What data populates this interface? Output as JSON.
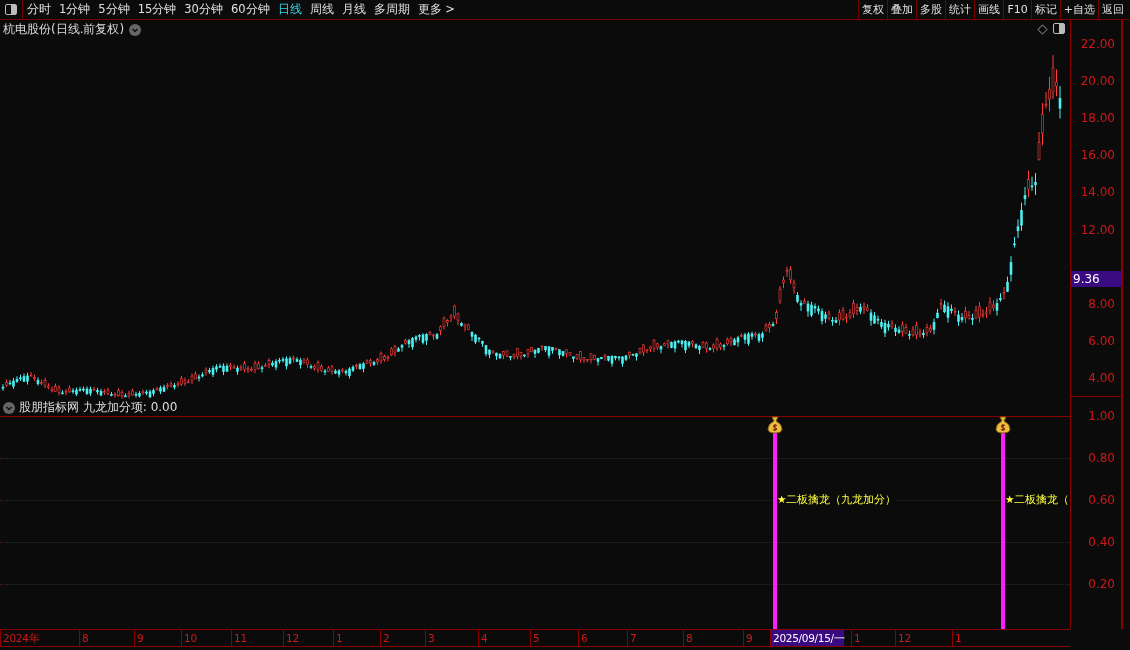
{
  "toolbar": {
    "periods": [
      {
        "label": "分时",
        "selected": false
      },
      {
        "label": "1分钟",
        "selected": false
      },
      {
        "label": "5分钟",
        "selected": false
      },
      {
        "label": "15分钟",
        "selected": false
      },
      {
        "label": "30分钟",
        "selected": false
      },
      {
        "label": "60分钟",
        "selected": false
      },
      {
        "label": "日线",
        "selected": true
      },
      {
        "label": "周线",
        "selected": false
      },
      {
        "label": "月线",
        "selected": false
      },
      {
        "label": "多周期",
        "selected": false
      }
    ],
    "more": "更多 >",
    "buttons": [
      "复权",
      "叠加",
      "多股",
      "统计",
      "画线",
      "F10",
      "标记",
      "+自选",
      "返回"
    ]
  },
  "price_chart": {
    "title": "杭电股份(日线.前复权)",
    "axis_labels": [
      "22.00",
      "20.00",
      "18.00",
      "16.00",
      "14.00",
      "12.00",
      "8.00",
      "6.00",
      "4.00"
    ],
    "current_price": "9.36"
  },
  "indicator": {
    "title": "股朋指标网 九龙加分项: 0.00",
    "axis_labels": [
      "1.00",
      "0.80",
      "0.60",
      "0.40",
      "0.20"
    ],
    "signals": [
      {
        "label": "★二板擒龙（九龙加分）"
      },
      {
        "label": "★二板擒龙（"
      }
    ]
  },
  "time_axis": [
    {
      "label": "2024年",
      "selected": false
    },
    {
      "label": "8",
      "selected": false
    },
    {
      "label": "9",
      "selected": false
    },
    {
      "label": "10",
      "selected": false
    },
    {
      "label": "11",
      "selected": false
    },
    {
      "label": "12",
      "selected": false
    },
    {
      "label": "1",
      "selected": false
    },
    {
      "label": "2",
      "selected": false
    },
    {
      "label": "3",
      "selected": false
    },
    {
      "label": "4",
      "selected": false
    },
    {
      "label": "5",
      "selected": false
    },
    {
      "label": "6",
      "selected": false
    },
    {
      "label": "7",
      "selected": false
    },
    {
      "label": "8",
      "selected": false
    },
    {
      "label": "9",
      "selected": false
    },
    {
      "label": "2025/09/15/一",
      "selected": true
    },
    {
      "label": "1",
      "selected": false
    },
    {
      "label": "12",
      "selected": false
    },
    {
      "label": "1",
      "selected": false
    }
  ]
}
